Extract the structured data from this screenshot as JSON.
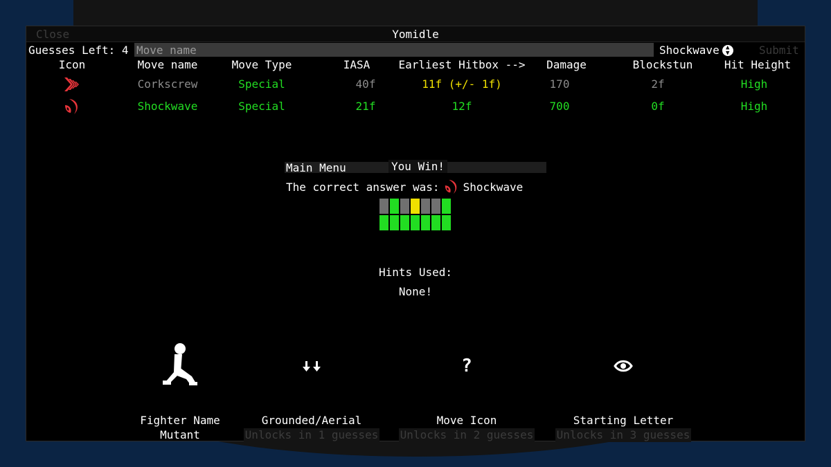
{
  "window": {
    "title": "Yomidle",
    "close_label": "Close"
  },
  "topbar": {
    "guesses_label": "Guesses Left: 4",
    "input_placeholder": "Move name",
    "select_value": "Shockwave",
    "submit_label": "Submit"
  },
  "columns": [
    "Icon",
    "Move name",
    "Move Type",
    "IASA",
    "Earliest Hitbox -->",
    "Damage",
    "Blockstun",
    "Hit Height"
  ],
  "rows": [
    {
      "icon": "corkscrew-icon",
      "move_name": "Corkscrew",
      "move_type": "Special",
      "iasa": "40f",
      "hitbox": "11f (+/- 1f)",
      "damage": "170",
      "blockstun": "2f",
      "hit_height": "High"
    },
    {
      "icon": "shockwave-icon",
      "move_name": "Shockwave",
      "move_type": "Special",
      "iasa": "21f",
      "hitbox": "12f",
      "damage": "700",
      "blockstun": "0f",
      "hit_height": "High"
    }
  ],
  "result": {
    "main_menu_label": "Main Menu",
    "win_label": "You Win!",
    "correct_label": "The correct answer was:",
    "answer": "Shockwave"
  },
  "hints": {
    "used_label": "Hints Used:",
    "used_value": "None!",
    "items": [
      {
        "icon": "fighter-silhouette-icon",
        "title": "Fighter Name",
        "sub": "Mutant"
      },
      {
        "icon": "down-arrows-icon",
        "title": "Grounded/Aerial",
        "sub": "Unlocks in 1 guesses"
      },
      {
        "icon": "question-mark-icon",
        "title": "Move Icon",
        "sub": "Unlocks in 2 guesses"
      },
      {
        "icon": "eye-icon",
        "title": "Starting Letter",
        "sub": "Unlocks in 3 guesses"
      }
    ]
  },
  "colors": {
    "correct": "#22dd22",
    "close": "#f0e000",
    "wrong": "#8c8c8c",
    "background": "#0b2444"
  }
}
